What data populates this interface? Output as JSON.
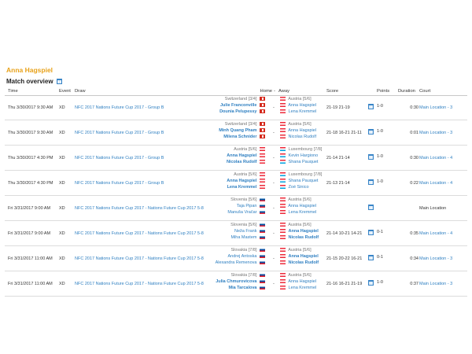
{
  "player_name": "Anna Hagspiel",
  "section_title": "Match overview",
  "headers": {
    "time": "Time",
    "event": "Event",
    "draw": "Draw",
    "home": "Home",
    "vs": "-",
    "away": "Away",
    "score": "Score",
    "points": "Points",
    "duration": "Duration",
    "court": "Court"
  },
  "matches": [
    {
      "time": "Thu 3/30/2017 9:30 AM",
      "event": "XD",
      "draw": "NFC 2017 Nations Future Cup 2017 - Group B",
      "home_team": "Switzerland",
      "home_seed": "[3/4]",
      "home_flag": "ch",
      "home_players": [
        "Julie Franconville",
        "Dounia Pelupessy"
      ],
      "home_win": true,
      "away_team": "Austria",
      "away_seed": "[5/6]",
      "away_flag": "at",
      "away_players": [
        "Anna Hagspiel",
        "Lena Kremmel"
      ],
      "away_win": false,
      "score": "21-19 21-19",
      "points": "1-0",
      "duration": "0:30",
      "court": "Main Location - 3",
      "court_link": true
    },
    {
      "time": "Thu 3/30/2017 9:30 AM",
      "event": "XD",
      "draw": "NFC 2017 Nations Future Cup 2017 - Group B",
      "home_team": "Switzerland",
      "home_seed": "[3/4]",
      "home_flag": "ch",
      "home_players": [
        "Minh Quang Pham",
        "Milena Schnider"
      ],
      "home_win": true,
      "away_team": "Austria",
      "away_seed": "[5/6]",
      "away_flag": "at",
      "away_players": [
        "Anna Hagspiel",
        "Nicolas Rudolf"
      ],
      "away_win": false,
      "score": "21-18 16-21 21-11",
      "points": "1-0",
      "duration": "0:01",
      "court": "Main Location - 3",
      "court_link": true
    },
    {
      "time": "Thu 3/30/2017 4:30 PM",
      "event": "XD",
      "draw": "NFC 2017 Nations Future Cup 2017 - Group B",
      "home_team": "Austria",
      "home_seed": "[5/6]",
      "home_flag": "at",
      "home_players": [
        "Anna Hagspiel",
        "Nicolas Rudolf"
      ],
      "home_win": true,
      "away_team": "Luxembourg",
      "away_seed": "[7/8]",
      "away_flag": "lu",
      "away_players": [
        "Kevin Hargiono",
        "Shana Pauquet"
      ],
      "away_win": false,
      "score": "21-14 21-14",
      "points": "1-0",
      "duration": "0:30",
      "court": "Main Location - 4",
      "court_link": true
    },
    {
      "time": "Thu 3/30/2017 4:30 PM",
      "event": "XD",
      "draw": "NFC 2017 Nations Future Cup 2017 - Group B",
      "home_team": "Austria",
      "home_seed": "[5/6]",
      "home_flag": "at",
      "home_players": [
        "Anna Hagspiel",
        "Lena Kremmel"
      ],
      "home_win": true,
      "away_team": "Luxembourg",
      "away_seed": "[7/8]",
      "away_flag": "lu",
      "away_players": [
        "Shana Pauquet",
        "Zoé Sinico"
      ],
      "away_win": false,
      "score": "21-13 21-14",
      "points": "1-0",
      "duration": "0:22",
      "court": "Main Location - 4",
      "court_link": true
    },
    {
      "time": "Fri 3/31/2017 9:00 AM",
      "event": "XD",
      "draw": "NFC 2017 Nations Future Cup 2017 - Nations Future Cup 2017 5-8",
      "home_team": "Slovenia",
      "home_seed": "[5/6]",
      "home_flag": "si",
      "home_players": [
        "Taja Pipan",
        "Manuša Vračar"
      ],
      "home_win": false,
      "away_team": "Austria",
      "away_seed": "[5/6]",
      "away_flag": "at",
      "away_players": [
        "Anna Hagspiel",
        "Lena Kremmel"
      ],
      "away_win": false,
      "score": "",
      "points": "",
      "duration": "",
      "court": "Main Location",
      "court_link": false
    },
    {
      "time": "Fri 3/31/2017 9:00 AM",
      "event": "XD",
      "draw": "NFC 2017 Nations Future Cup 2017 - Nations Future Cup 2017 5-8",
      "home_team": "Slovenia",
      "home_seed": "[5/6]",
      "home_flag": "si",
      "home_players": [
        "Neža Frank",
        "Miha Mastem"
      ],
      "home_win": false,
      "away_team": "Austria",
      "away_seed": "[5/6]",
      "away_flag": "at",
      "away_players": [
        "Anna Hagspiel",
        "Nicolas Rudolf"
      ],
      "away_win": true,
      "score": "21-14 10-21 14-21",
      "points": "0-1",
      "duration": "0:35",
      "court": "Main Location - 4",
      "court_link": true
    },
    {
      "time": "Fri 3/31/2017 11:00 AM",
      "event": "XD",
      "draw": "NFC 2017 Nations Future Cup 2017 - Nations Future Cup 2017 5-8",
      "home_team": "Slovakia",
      "home_seed": "[7/8]",
      "home_flag": "sk",
      "home_players": [
        "Andrej Antoska",
        "Alexandra Remenova"
      ],
      "home_win": false,
      "away_team": "Austria",
      "away_seed": "[5/6]",
      "away_flag": "at",
      "away_players": [
        "Anna Hagspiel",
        "Nicolas Rudolf"
      ],
      "away_win": true,
      "score": "21-15 20-22 16-21",
      "points": "0-1",
      "duration": "0:34",
      "court": "Main Location - 3",
      "court_link": true
    },
    {
      "time": "Fri 3/31/2017 11:00 AM",
      "event": "XD",
      "draw": "NFC 2017 Nations Future Cup 2017 - Nations Future Cup 2017 5-8",
      "home_team": "Slovakia",
      "home_seed": "[7/8]",
      "home_flag": "sk",
      "home_players": [
        "Julia Chmurovicova",
        "Mia Tarcalova"
      ],
      "home_win": true,
      "away_team": "Austria",
      "away_seed": "[5/6]",
      "away_flag": "at",
      "away_players": [
        "Anna Hagspiel",
        "Lena Kremmel"
      ],
      "away_win": false,
      "score": "21-16 16-21 21-19",
      "points": "1-0",
      "duration": "0:37",
      "court": "Main Location - 3",
      "court_link": true
    }
  ]
}
